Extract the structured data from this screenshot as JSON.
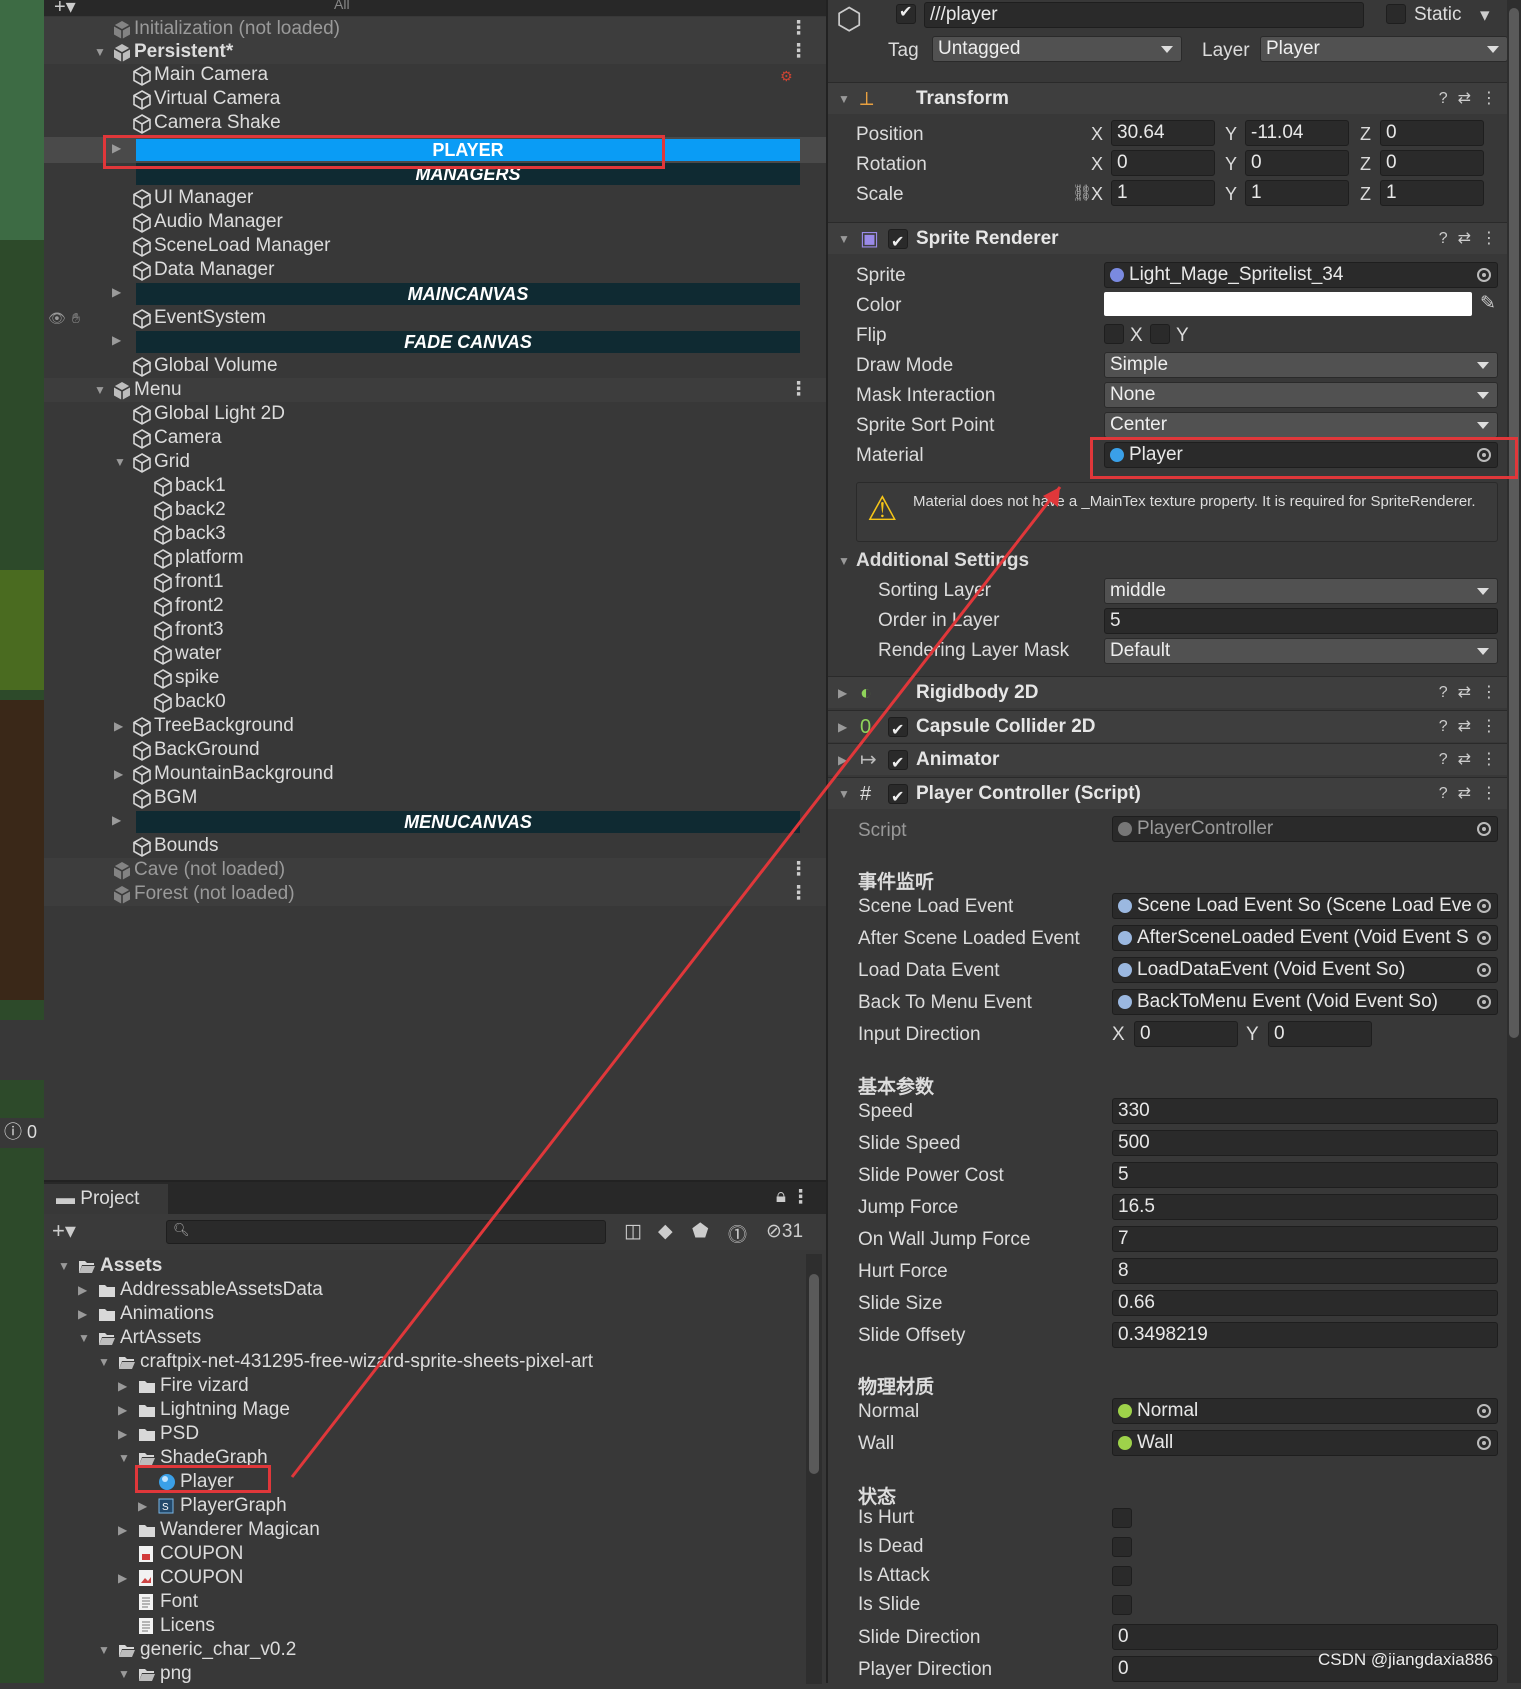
{
  "hierarchy": {
    "search_placeholder": "All",
    "scenes": [
      {
        "label": "Initialization (not loaded)"
      },
      {
        "label": "Persistent*"
      },
      {
        "label": "Menu"
      },
      {
        "label": "Cave (not loaded)"
      },
      {
        "label": "Forest (not loaded)"
      }
    ],
    "persistent_items": [
      "Main Camera",
      "Virtual Camera",
      "Camera Shake"
    ],
    "player_bar": "PLAYER",
    "managers_bar": "MANAGERS",
    "managers": [
      "UI Manager",
      "Audio Manager",
      "SceneLoad Manager",
      "Data Manager"
    ],
    "maincanvas_bar": "MAINCANVAS",
    "eventsystem": "EventSystem",
    "fadecanvas_bar": "FADE CANVAS",
    "global_volume": "Global Volume",
    "menu_items": [
      "Global Light 2D",
      "Camera",
      "Grid"
    ],
    "grid_children": [
      "back1",
      "back2",
      "back3",
      "platform",
      "front1",
      "front2",
      "front3",
      "water",
      "spike",
      "back0"
    ],
    "menu_items2": [
      "TreeBackground",
      "BackGround",
      "MountainBackground",
      "BGM"
    ],
    "menucanvas_bar": "MENUCANVAS",
    "bounds": "Bounds",
    "left_counter": "0"
  },
  "project": {
    "tab": "Project",
    "hidden_count": "31",
    "tree": [
      {
        "label": "Assets",
        "depth": 0,
        "arrow": "down",
        "icon": "open-folder"
      },
      {
        "label": "AddressableAssetsData",
        "depth": 1,
        "arrow": "right",
        "icon": "folder"
      },
      {
        "label": "Animations",
        "depth": 1,
        "arrow": "right",
        "icon": "folder"
      },
      {
        "label": "ArtAssets",
        "depth": 1,
        "arrow": "down",
        "icon": "open-folder"
      },
      {
        "label": "craftpix-net-431295-free-wizard-sprite-sheets-pixel-art",
        "depth": 2,
        "arrow": "down",
        "icon": "open-folder"
      },
      {
        "label": "Fire vizard",
        "depth": 3,
        "arrow": "right",
        "icon": "folder"
      },
      {
        "label": "Lightning Mage",
        "depth": 3,
        "arrow": "right",
        "icon": "folder"
      },
      {
        "label": "PSD",
        "depth": 3,
        "arrow": "right",
        "icon": "folder"
      },
      {
        "label": "ShadeGraph",
        "depth": 3,
        "arrow": "down",
        "icon": "open-folder"
      },
      {
        "label": "Player",
        "depth": 4,
        "arrow": "",
        "icon": "material"
      },
      {
        "label": "PlayerGraph",
        "depth": 4,
        "arrow": "right",
        "icon": "shadergraph"
      },
      {
        "label": "Wanderer Magican",
        "depth": 3,
        "arrow": "right",
        "icon": "folder"
      },
      {
        "label": "COUPON",
        "depth": 3,
        "arrow": "",
        "icon": "pdf"
      },
      {
        "label": "COUPON",
        "depth": 3,
        "arrow": "right",
        "icon": "image"
      },
      {
        "label": "Font",
        "depth": 3,
        "arrow": "",
        "icon": "doc"
      },
      {
        "label": "Licens",
        "depth": 3,
        "arrow": "",
        "icon": "doc"
      },
      {
        "label": "generic_char_v0.2",
        "depth": 2,
        "arrow": "down",
        "icon": "open-folder"
      },
      {
        "label": "png",
        "depth": 3,
        "arrow": "down",
        "icon": "open-folder"
      }
    ]
  },
  "inspector": {
    "name": "///player",
    "static_label": "Static",
    "tag_label": "Tag",
    "tag_value": "Untagged",
    "layer_label": "Layer",
    "layer_value": "Player",
    "transform": {
      "title": "Transform",
      "rows": [
        {
          "label": "Position",
          "x": "30.64",
          "y": "-11.04",
          "z": "0"
        },
        {
          "label": "Rotation",
          "x": "0",
          "y": "0",
          "z": "0"
        },
        {
          "label": "Scale",
          "x": "1",
          "y": "1",
          "z": "1"
        }
      ]
    },
    "sprite_renderer": {
      "title": "Sprite Renderer",
      "sprite_label": "Sprite",
      "sprite_value": "Light_Mage_Spritelist_34",
      "color_label": "Color",
      "flip_label": "Flip",
      "flip_x": "X",
      "flip_y": "Y",
      "draw_mode_label": "Draw Mode",
      "draw_mode": "Simple",
      "mask_label": "Mask Interaction",
      "mask": "None",
      "sort_point_label": "Sprite Sort Point",
      "sort_point": "Center",
      "material_label": "Material",
      "material": "Player",
      "warning": "Material does not have a _MainTex texture property. It is required for SpriteRenderer.",
      "additional": "Additional Settings",
      "sorting_layer_label": "Sorting Layer",
      "sorting_layer": "middle",
      "order_label": "Order in Layer",
      "order": "5",
      "rendering_mask_label": "Rendering Layer Mask",
      "rendering_mask": "Default"
    },
    "components": [
      "Rigidbody 2D",
      "Capsule Collider 2D",
      "Animator",
      "Player Controller (Script)"
    ],
    "script": {
      "script_label": "Script",
      "script_value": "PlayerController",
      "sec_events": "事件监听",
      "events": [
        {
          "label": "Scene Load Event",
          "value": "Scene Load Event So (Scene Load Eve"
        },
        {
          "label": "After Scene Loaded Event",
          "value": "AfterSceneLoaded Event (Void Event S"
        },
        {
          "label": "Load Data Event",
          "value": "LoadDataEvent (Void Event So)"
        },
        {
          "label": "Back To Menu Event",
          "value": "BackToMenu Event (Void Event So)"
        }
      ],
      "input_label": "Input Direction",
      "input_x": "0",
      "input_y": "0",
      "sec_basic": "基本参数",
      "params": [
        {
          "label": "Speed",
          "value": "330"
        },
        {
          "label": "Slide Speed",
          "value": "500"
        },
        {
          "label": "Slide Power Cost",
          "value": "5"
        },
        {
          "label": "Jump Force",
          "value": "16.5"
        },
        {
          "label": "On Wall Jump Force",
          "value": "7"
        },
        {
          "label": "Hurt Force",
          "value": "8"
        },
        {
          "label": "Slide Size",
          "value": "0.66"
        },
        {
          "label": "Slide Offsety",
          "value": "0.3498219"
        }
      ],
      "sec_physics": "物理材质",
      "physics": [
        {
          "label": "Normal",
          "value": "Normal"
        },
        {
          "label": "Wall",
          "value": "Wall"
        }
      ],
      "sec_state": "状态",
      "states": [
        "Is Hurt",
        "Is Dead",
        "Is Attack",
        "Is Slide"
      ],
      "slide_dir_label": "Slide Direction",
      "slide_dir": "0",
      "player_dir_label": "Player Direction",
      "player_dir": "0"
    }
  },
  "watermark": "CSDN @jiangdaxia886",
  "colors": {
    "selection": "#0a9cf5",
    "highlight": "#e0373a",
    "panel": "#383838"
  }
}
